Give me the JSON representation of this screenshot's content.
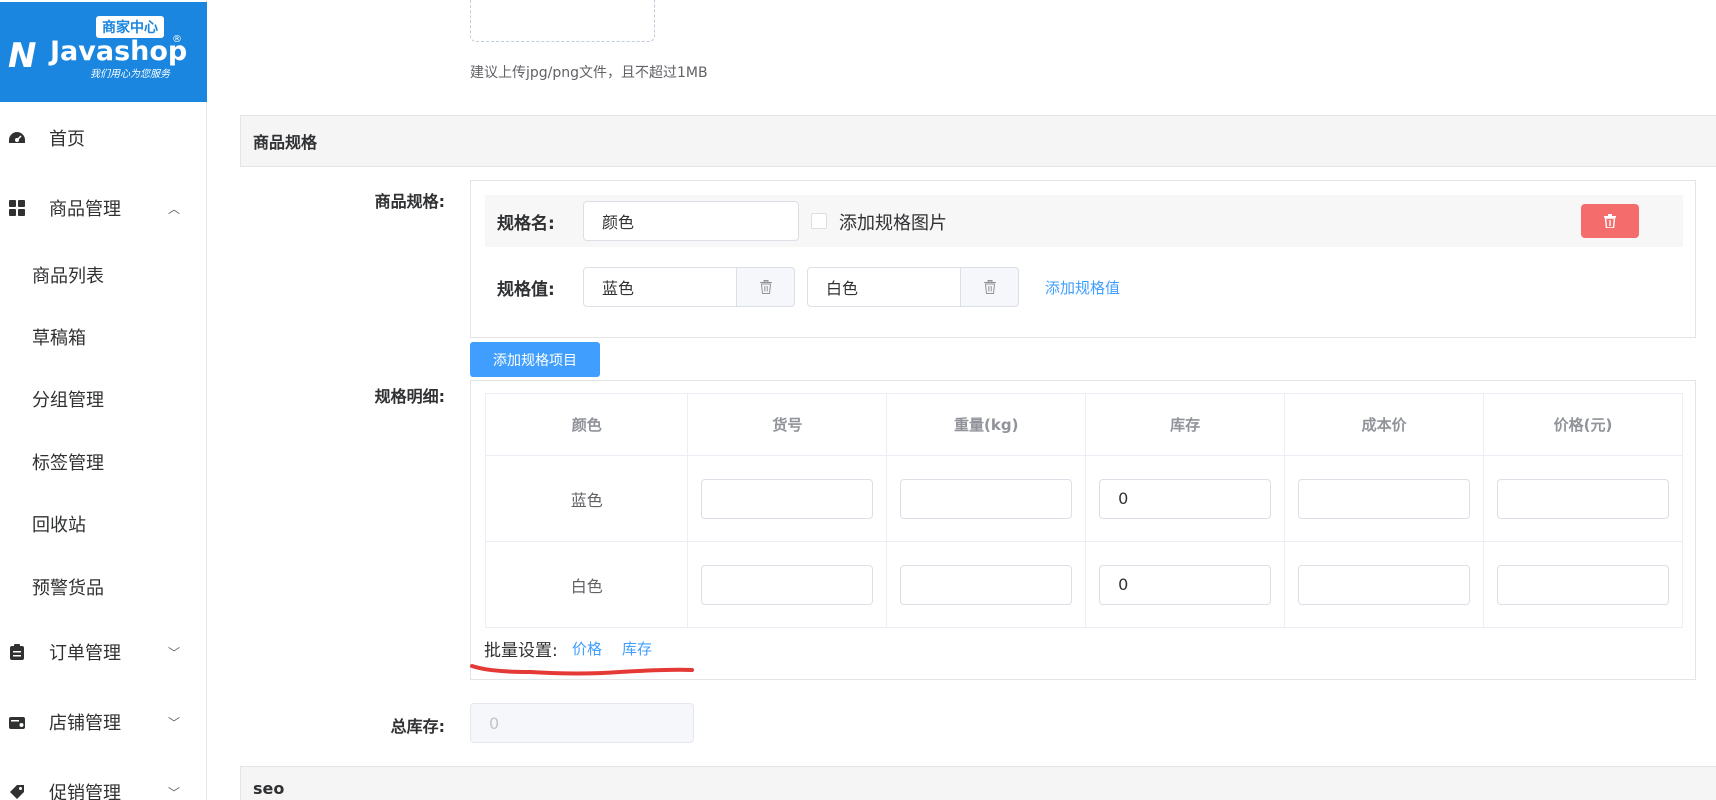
{
  "logo": {
    "badge": "商家中心",
    "mark": "N",
    "name": "Javashop",
    "reg": "®",
    "slogan": "我们用心为您服务"
  },
  "sidebar": {
    "items": [
      {
        "label": "首页",
        "icon": "dashboard-icon"
      },
      {
        "label": "商品管理",
        "icon": "grid-icon",
        "expanded": true
      },
      {
        "label": "订单管理",
        "icon": "clipboard-icon"
      },
      {
        "label": "店铺管理",
        "icon": "store-icon"
      },
      {
        "label": "促销管理",
        "icon": "tag-icon"
      }
    ],
    "subitems": [
      "商品列表",
      "草稿箱",
      "分组管理",
      "标签管理",
      "回收站",
      "预警货品"
    ]
  },
  "upload": {
    "tip": "建议上传jpg/png文件，且不超过1MB"
  },
  "spec_section": {
    "title": "商品规格",
    "spec_label": "商品规格:",
    "spec_name_label": "规格名:",
    "spec_name_value": "颜色",
    "add_image_label": "添加规格图片",
    "spec_value_label": "规格值:",
    "spec_values": [
      "蓝色",
      "白色"
    ],
    "add_value_link": "添加规格值",
    "add_item_button": "添加规格项目",
    "detail_label": "规格明细:",
    "table": {
      "headers": [
        "颜色",
        "货号",
        "重量(kg)",
        "库存",
        "成本价",
        "价格(元)"
      ],
      "rows": [
        {
          "color": "蓝色",
          "sku": "",
          "weight": "",
          "stock": "0",
          "cost": "",
          "price": ""
        },
        {
          "color": "白色",
          "sku": "",
          "weight": "",
          "stock": "0",
          "cost": "",
          "price": ""
        }
      ]
    },
    "batch_label": "批量设置:",
    "batch_price": "价格",
    "batch_stock": "库存",
    "total_stock_label": "总库存:",
    "total_stock_value": "0"
  },
  "seo_section": {
    "title": "seo"
  },
  "colors": {
    "primary": "#409eff",
    "danger": "#f56c6c",
    "logo_bg": "#1a86e0",
    "annotation": "#e53935"
  }
}
